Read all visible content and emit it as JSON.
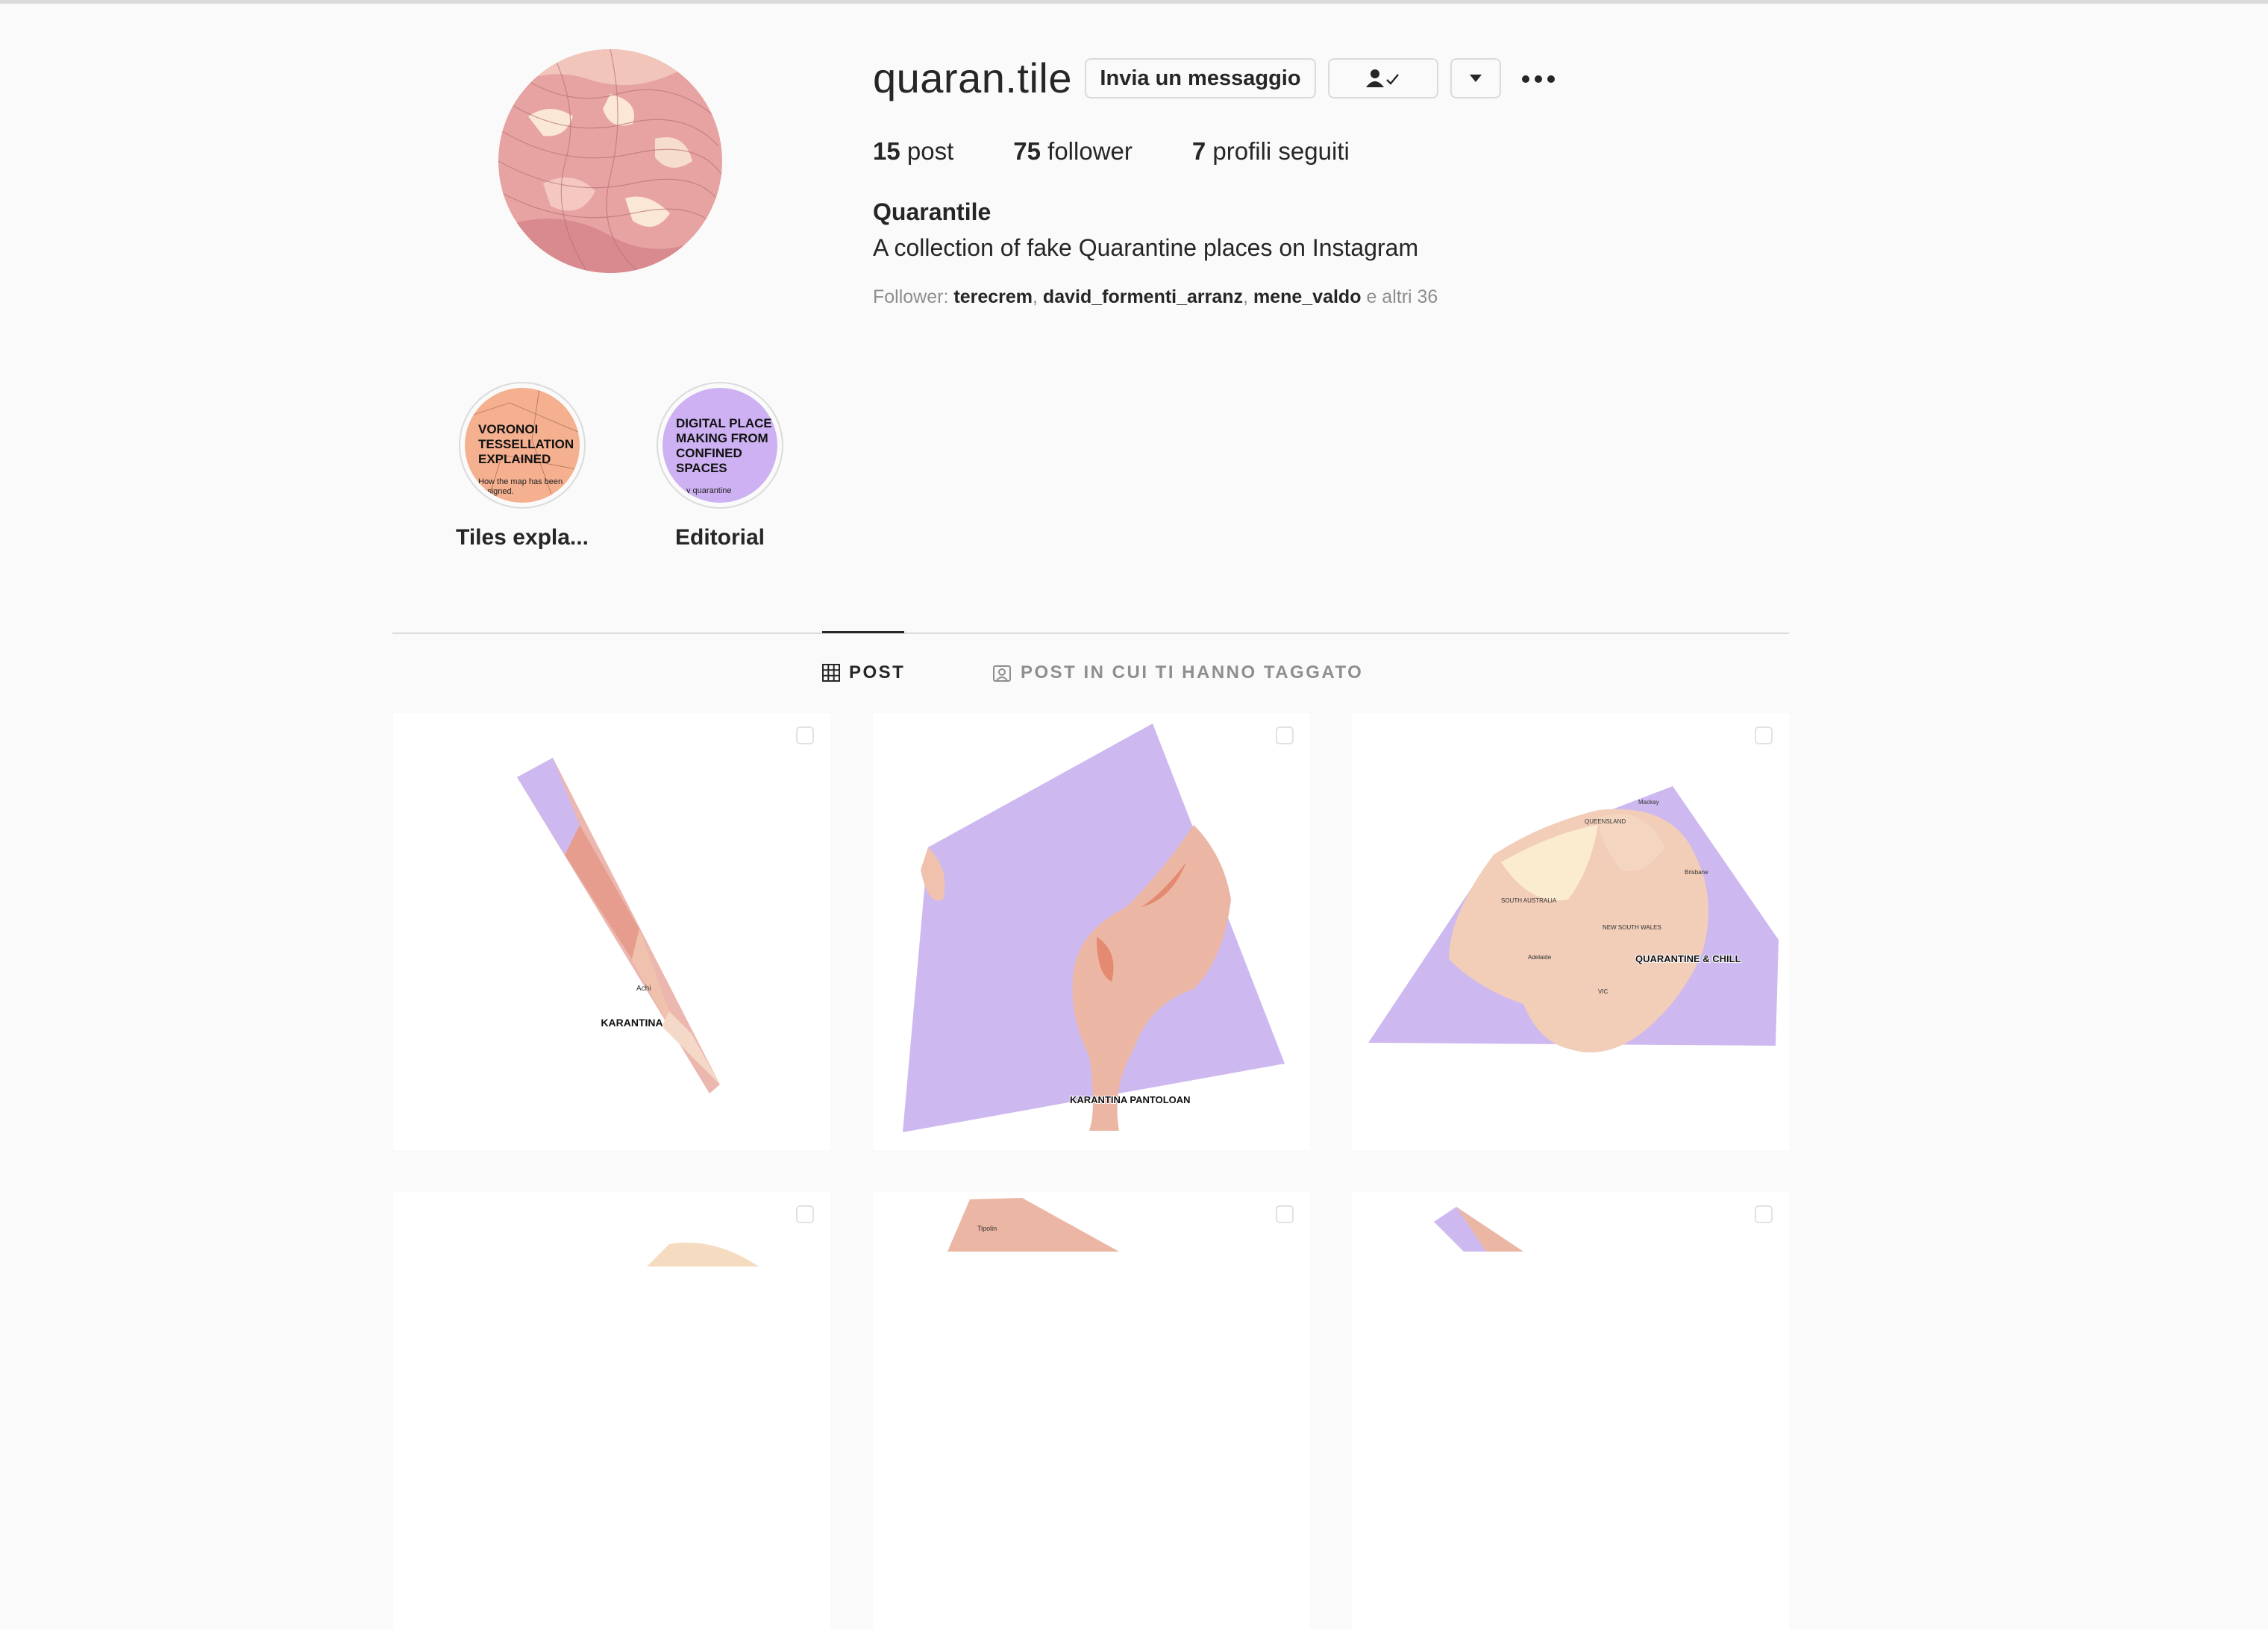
{
  "profile": {
    "username": "quaran.tile",
    "buttons": {
      "message": "Invia un messaggio",
      "follow_icon": "person-check-icon",
      "dropdown_icon": "caret-down-icon",
      "more_icon": "more-dots-icon"
    },
    "stats": [
      {
        "count": "15",
        "label": "post"
      },
      {
        "count": "75",
        "label": "follower"
      },
      {
        "count": "7",
        "label": "profili seguiti"
      }
    ],
    "full_name": "Quarantile",
    "bio": "A collection of fake Quarantine places on Instagram",
    "followed_by": {
      "prefix": "Follower:",
      "names": [
        "terecrem",
        "david_formenti_arranz",
        "mene_valdo"
      ],
      "suffix": "e altri 36"
    }
  },
  "highlights": [
    {
      "label": "Tiles expla...",
      "cover_title": "VORONOI TESSELLATION EXPLAINED",
      "cover_sub": "How the map has been designed.",
      "color": "#f4b08f"
    },
    {
      "label": "Editorial",
      "cover_title": "DIGITAL PLACE MAKING FROM CONFINED SPACES",
      "cover_sub": "y quarantine",
      "color": "#cdb1f2"
    }
  ],
  "tabs": [
    {
      "label": "POST",
      "icon": "grid-icon",
      "active": true
    },
    {
      "label": "POST IN CUI TI HANNO TAGGATO",
      "icon": "tagged-icon",
      "active": false
    }
  ],
  "posts": [
    {
      "place": "KARANTINA",
      "extra": "Achi",
      "multi": true
    },
    {
      "place": "KARANTINA PANTOLOAN",
      "multi": true
    },
    {
      "place": "QUARANTINE & CHILL",
      "labels": [
        "QUEENSLAND",
        "SOUTH AUSTRALIA",
        "NEW SOUTH WALES",
        "Brisbane",
        "Adelaide",
        "VIC",
        "Mackay"
      ],
      "multi": true
    },
    {
      "multi": true
    },
    {
      "place": "Tipolin",
      "multi": true
    },
    {
      "multi": true
    }
  ],
  "colors": {
    "accent_purple": "#cdb9f0",
    "land_pink": "#f0c2ae",
    "text": "#262626",
    "muted": "#8e8e8e"
  }
}
